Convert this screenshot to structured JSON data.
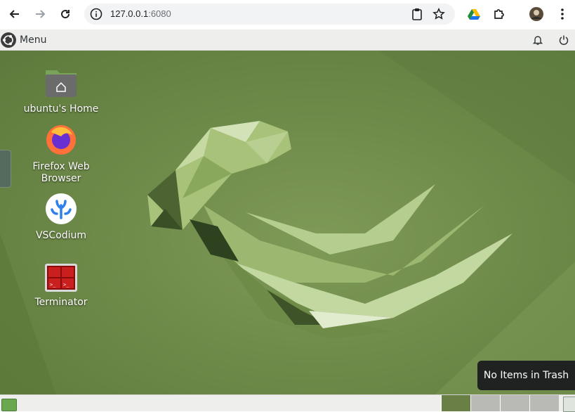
{
  "browser": {
    "url_host": "127.0.0.1",
    "url_port": ":6080"
  },
  "panel": {
    "menu_label": "Menu"
  },
  "desktop": {
    "icons": [
      {
        "label": "ubuntu's Home",
        "icon": "home-folder-icon"
      },
      {
        "label": "Firefox Web Browser",
        "icon": "firefox-icon"
      },
      {
        "label": "VSCodium",
        "icon": "vscodium-icon"
      },
      {
        "label": "Terminator",
        "icon": "terminator-icon"
      }
    ],
    "toast": "No Items in Trash"
  },
  "colors": {
    "wallpaper": "#6f8b4a",
    "panel": "#eeeeec",
    "toast_bg": "#1f2220"
  }
}
